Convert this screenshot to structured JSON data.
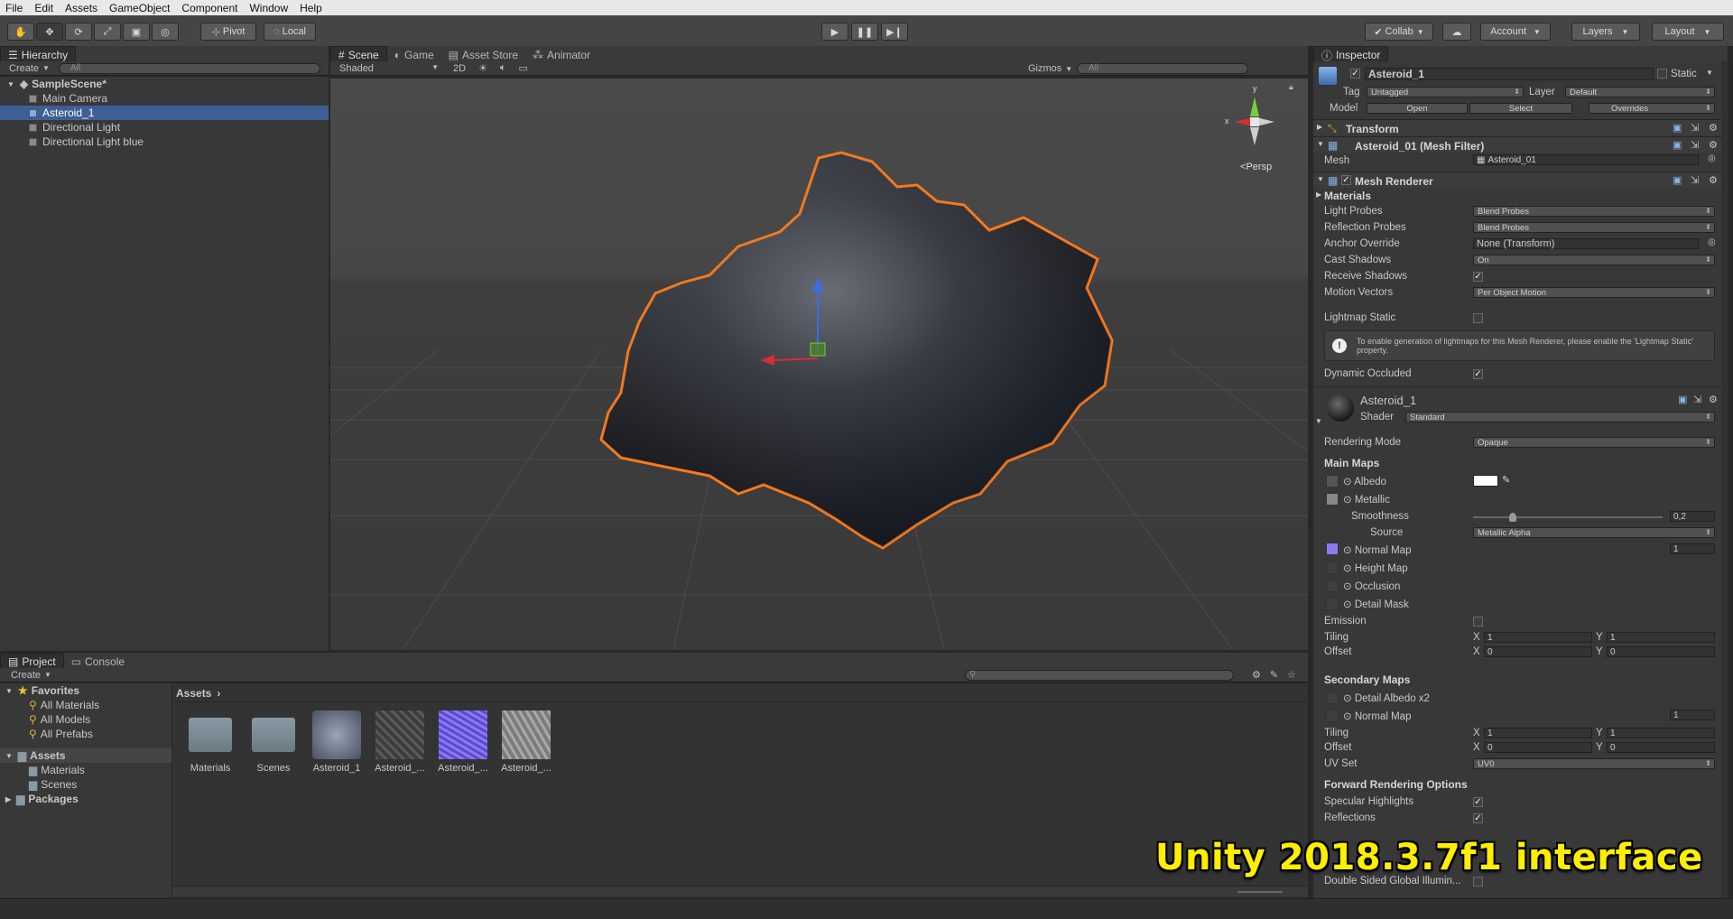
{
  "menu": [
    "File",
    "Edit",
    "Assets",
    "GameObject",
    "Component",
    "Window",
    "Help"
  ],
  "toolbar": {
    "pivot": "Pivot",
    "local": "Local",
    "collab": "Collab",
    "account": "Account",
    "layers": "Layers",
    "layout": "Layout"
  },
  "hierarchy": {
    "tab": "Hierarchy",
    "create": "Create",
    "search_placeholder": "All",
    "scene": "SampleScene*",
    "items": [
      "Main Camera",
      "Asteroid_1",
      "Directional Light",
      "Directional Light blue"
    ],
    "selected_index": 1
  },
  "scene_view": {
    "tabs": [
      "Scene",
      "Game",
      "Asset Store",
      "Animator"
    ],
    "shading": "Shaded",
    "mode_2d": "2D",
    "gizmos": "Gizmos",
    "search_placeholder": "All",
    "persp": "Persp",
    "axis_x": "x",
    "axis_y": "y"
  },
  "project": {
    "tabs": [
      "Project",
      "Console"
    ],
    "create": "Create",
    "favorites": "Favorites",
    "favorite_items": [
      "All Materials",
      "All Models",
      "All Prefabs"
    ],
    "assets_root": "Assets",
    "asset_folders": [
      "Materials",
      "Scenes"
    ],
    "packages": "Packages",
    "breadcrumb": "Assets",
    "assets": [
      "Materials",
      "Scenes",
      "Asteroid_1",
      "Asteroid_...",
      "Asteroid_...",
      "Asteroid_..."
    ]
  },
  "inspector": {
    "tab": "Inspector",
    "object_name": "Asteroid_1",
    "static": "Static",
    "tag_label": "Tag",
    "tag": "Untagged",
    "layer_label": "Layer",
    "layer": "Default",
    "model_label": "Model",
    "model_open": "Open",
    "model_select": "Select",
    "model_overrides": "Overrides",
    "transform": "Transform",
    "mesh_filter": "Asteroid_01 (Mesh Filter)",
    "mesh_label": "Mesh",
    "mesh_value": "Asteroid_01",
    "mesh_renderer": "Mesh Renderer",
    "materials": "Materials",
    "light_probes_label": "Light Probes",
    "light_probes": "Blend Probes",
    "reflection_probes_label": "Reflection Probes",
    "reflection_probes": "Blend Probes",
    "anchor_override_label": "Anchor Override",
    "anchor_override": "None (Transform)",
    "cast_shadows_label": "Cast Shadows",
    "cast_shadows": "On",
    "receive_shadows_label": "Receive Shadows",
    "motion_vectors_label": "Motion Vectors",
    "motion_vectors": "Per Object Motion",
    "lightmap_static_label": "Lightmap Static",
    "lightmap_info": "To enable generation of lightmaps for this Mesh Renderer, please enable the 'Lightmap Static' property.",
    "dynamic_occluded_label": "Dynamic Occluded",
    "material_name": "Asteroid_1",
    "shader_label": "Shader",
    "shader": "Standard",
    "rendering_mode_label": "Rendering Mode",
    "rendering_mode": "Opaque",
    "main_maps": "Main Maps",
    "albedo": "Albedo",
    "metallic": "Metallic",
    "smoothness": "Smoothness",
    "smoothness_value": "0,2",
    "smoothness_fraction": 0.2,
    "source_label": "Source",
    "source": "Metallic Alpha",
    "normal_map": "Normal Map",
    "normal_value": "1",
    "height_map": "Height Map",
    "occlusion": "Occlusion",
    "detail_mask": "Detail Mask",
    "emission": "Emission",
    "tiling": "Tiling",
    "offset": "Offset",
    "x_label": "X",
    "y_label": "Y",
    "tiling_x": "1",
    "tiling_y": "1",
    "offset_x": "0",
    "offset_y": "0",
    "secondary_maps": "Secondary Maps",
    "detail_albedo": "Detail Albedo x2",
    "normal_map2": "Normal Map",
    "normal_value2": "1",
    "tiling2_x": "1",
    "tiling2_y": "1",
    "offset2_x": "0",
    "offset2_y": "0",
    "uv_set_label": "UV Set",
    "uv_set": "UV0",
    "forward_options": "Forward Rendering Options",
    "specular_highlights": "Specular Highlights",
    "reflections": "Reflections",
    "double_sided": "Double Sided Global Illumin..."
  },
  "overlay_caption": "Unity 2018.3.7f1 interface",
  "colors": {
    "selection": "#3e5f96",
    "outline": "#ff7a1a",
    "caption": "#ffee00"
  }
}
